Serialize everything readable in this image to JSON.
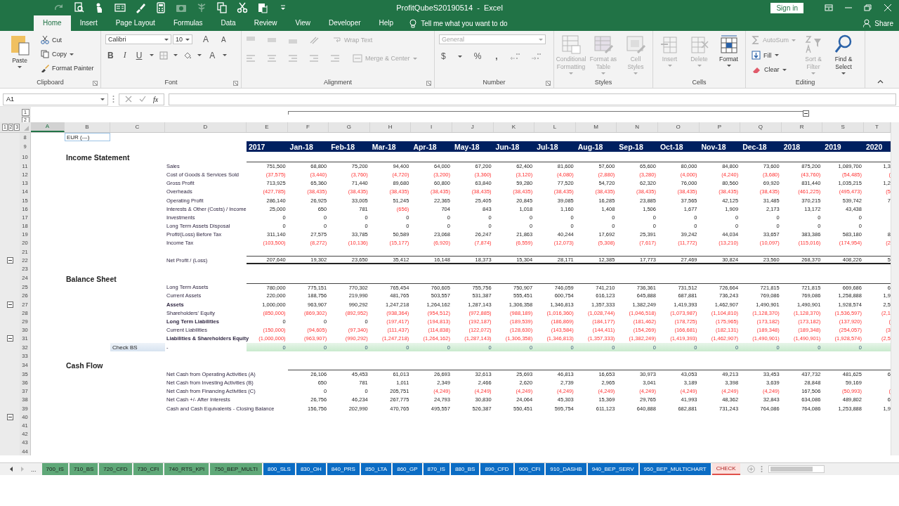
{
  "window": {
    "title": "ProfitQubeS20190514  -  Excel",
    "sign_in": "Sign in"
  },
  "quick_access": [
    {
      "kind": "redo",
      "disabled": true
    },
    {
      "kind": "preview",
      "disabled": false
    },
    {
      "kind": "touch",
      "disabled": false
    },
    {
      "kind": "form",
      "disabled": false
    },
    {
      "kind": "brush",
      "disabled": false
    },
    {
      "kind": "calculator",
      "disabled": false
    },
    {
      "kind": "camera",
      "disabled": true
    },
    {
      "kind": "tree",
      "disabled": true
    },
    {
      "kind": "copy",
      "disabled": false
    },
    {
      "kind": "cut",
      "disabled": false
    },
    {
      "kind": "paste",
      "disabled": false
    },
    {
      "kind": "customize",
      "disabled": false
    }
  ],
  "ribbon_tabs": [
    {
      "label": "Home",
      "selected": true
    },
    {
      "label": "Insert",
      "selected": false
    },
    {
      "label": "Page Layout",
      "selected": false
    },
    {
      "label": "Formulas",
      "selected": false
    },
    {
      "label": "Data",
      "selected": false
    },
    {
      "label": "Review",
      "selected": false
    },
    {
      "label": "View",
      "selected": false
    },
    {
      "label": "Developer",
      "selected": false
    },
    {
      "label": "Help",
      "selected": false
    }
  ],
  "tell_me": "Tell me what you want to do",
  "share": "Share",
  "ribbon": [
    {
      "kind": "clipboard",
      "label": "Clipboard",
      "paste": "Paste",
      "cut": "Cut",
      "copy": "Copy",
      "format_painter": "Format Painter"
    },
    {
      "kind": "font",
      "label": "Font",
      "font_name": "Calibri",
      "font_size": "10",
      "grow": "A",
      "shrink": "A",
      "bold": "B",
      "italic": "I",
      "underline": "U",
      "font_color": "A"
    },
    {
      "kind": "alignment",
      "label": "Alignment",
      "wrap_text": "Wrap Text",
      "merge": "Merge & Center",
      "disabled": true
    },
    {
      "kind": "number",
      "label": "Number",
      "format": "General",
      "currency": "$",
      "percent": "%",
      "comma": ",",
      "disabled": true
    },
    {
      "kind": "styles",
      "label": "Styles",
      "buttons": [
        {
          "label": "Conditional Formatting",
          "disabled": true
        },
        {
          "label": "Format as Table",
          "disabled": true
        },
        {
          "label": "Cell Styles",
          "disabled": true
        }
      ]
    },
    {
      "kind": "cells",
      "label": "Cells",
      "buttons": [
        {
          "label": "Insert",
          "disabled": true
        },
        {
          "label": "Delete",
          "disabled": true
        },
        {
          "label": "Format",
          "disabled": false
        }
      ]
    },
    {
      "kind": "editing",
      "label": "Editing",
      "autosum": {
        "label": "AutoSum",
        "disabled": true
      },
      "fill": "Fill",
      "clear": "Clear",
      "sort": {
        "label": "Sort & Filter",
        "disabled": true
      },
      "find": "Find & Select"
    }
  ],
  "formula_bar": {
    "name_box": "A1",
    "function_label": "fx"
  },
  "outline": {
    "column_levels": [
      "1",
      "2"
    ],
    "row_levels": [
      "1",
      "2",
      "3"
    ]
  },
  "columns": [
    {
      "label": "A",
      "selected": true
    },
    {
      "label": "B",
      "selected": false
    },
    {
      "label": "C",
      "selected": false
    },
    {
      "label": "D",
      "selected": false
    },
    {
      "label": "E",
      "selected": false
    },
    {
      "label": "F",
      "selected": false
    },
    {
      "label": "G",
      "selected": false
    },
    {
      "label": "H",
      "selected": false
    },
    {
      "label": "I",
      "selected": false
    },
    {
      "label": "J",
      "selected": false
    },
    {
      "label": "K",
      "selected": false
    },
    {
      "label": "L",
      "selected": false
    },
    {
      "label": "M",
      "selected": false
    },
    {
      "label": "N",
      "selected": false
    },
    {
      "label": "O",
      "selected": false
    },
    {
      "label": "P",
      "selected": false
    },
    {
      "label": "Q",
      "selected": false
    },
    {
      "label": "R",
      "selected": false
    },
    {
      "label": "S",
      "selected": false
    },
    {
      "label": "T",
      "selected": false
    }
  ],
  "rows": [
    {
      "number": "8",
      "kind": "currency",
      "collapse": false,
      "text": "EUR (---)"
    },
    {
      "number": "9",
      "kind": "header",
      "collapse": false,
      "values": [
        "2017",
        "Jan-18",
        "Feb-18",
        "Mar-18",
        "Apr-18",
        "May-18",
        "Jun-18",
        "Jul-18",
        "Aug-18",
        "Sep-18",
        "Oct-18",
        "Nov-18",
        "Dec-18",
        "2018",
        "2019",
        "2020"
      ]
    },
    {
      "number": "10",
      "kind": "title",
      "collapse": false,
      "text": "Income Statement"
    },
    {
      "number": "11",
      "kind": "line",
      "collapse": false,
      "rule_above": true,
      "label": "Sales",
      "values": [
        "751,500",
        "68,800",
        "75,200",
        "94,400",
        "64,000",
        "67,200",
        "62,400",
        "81,600",
        "57,600",
        "65,600",
        "80,000",
        "84,800",
        "73,600",
        "875,200",
        "1,089,700",
        "1,3"
      ]
    },
    {
      "number": "12",
      "kind": "line",
      "collapse": false,
      "red": true,
      "label": "Cost of Goods & Services Sold",
      "values": [
        "(37,575)",
        "(3,440)",
        "(3,760)",
        "(4,720)",
        "(3,200)",
        "(3,360)",
        "(3,120)",
        "(4,080)",
        "(2,880)",
        "(3,280)",
        "(4,000)",
        "(4,240)",
        "(3,680)",
        "(43,760)",
        "(54,485)",
        "("
      ]
    },
    {
      "number": "13",
      "kind": "line",
      "collapse": false,
      "label": "Gross Profit",
      "values": [
        "713,925",
        "65,360",
        "71,440",
        "89,680",
        "60,800",
        "63,840",
        "59,280",
        "77,520",
        "54,720",
        "62,320",
        "76,000",
        "80,560",
        "69,920",
        "831,440",
        "1,035,215",
        "1,2"
      ]
    },
    {
      "number": "14",
      "kind": "line",
      "collapse": false,
      "red": true,
      "label": "Overheads",
      "values": [
        "(427,785)",
        "(38,435)",
        "(38,435)",
        "(38,435)",
        "(38,435)",
        "(38,435)",
        "(38,435)",
        "(38,435)",
        "(38,435)",
        "(38,435)",
        "(38,435)",
        "(38,435)",
        "(38,435)",
        "(461,225)",
        "(495,473)",
        "(5"
      ]
    },
    {
      "number": "15",
      "kind": "line",
      "collapse": false,
      "label": "Operating Profit",
      "values": [
        "286,140",
        "26,925",
        "33,005",
        "51,245",
        "22,365",
        "25,405",
        "20,845",
        "39,085",
        "16,285",
        "23,885",
        "37,565",
        "42,125",
        "31,485",
        "370,215",
        "539,742",
        "7"
      ]
    },
    {
      "number": "16",
      "kind": "line",
      "collapse": false,
      "label": "Interests & Other (Costs) / Income",
      "red_cells": [
        false,
        false,
        false,
        true,
        false,
        false,
        false,
        false,
        false,
        false,
        false,
        false,
        false,
        false,
        false
      ],
      "values": [
        "25,000",
        "650",
        "781",
        "(656)",
        "704",
        "843",
        "1,018",
        "1,160",
        "1,408",
        "1,506",
        "1,677",
        "1,909",
        "2,173",
        "13,172",
        "43,438"
      ]
    },
    {
      "number": "17",
      "kind": "line",
      "collapse": false,
      "label": "Investments",
      "values": [
        "0",
        "0",
        "0",
        "0",
        "0",
        "0",
        "0",
        "0",
        "0",
        "0",
        "0",
        "0",
        "0",
        "0",
        "0"
      ]
    },
    {
      "number": "18",
      "kind": "line",
      "collapse": false,
      "label": "Long Term Assets Disposal",
      "values": [
        "0",
        "0",
        "0",
        "0",
        "0",
        "0",
        "0",
        "0",
        "0",
        "0",
        "0",
        "0",
        "0",
        "0",
        "0"
      ]
    },
    {
      "number": "19",
      "kind": "line",
      "collapse": false,
      "label": "Profit/(Loss) Before Tax",
      "values": [
        "311,140",
        "27,575",
        "33,785",
        "50,589",
        "23,068",
        "26,247",
        "21,863",
        "40,244",
        "17,692",
        "25,391",
        "39,242",
        "44,034",
        "33,657",
        "383,386",
        "583,180",
        "8"
      ]
    },
    {
      "number": "20",
      "kind": "line",
      "collapse": false,
      "red": true,
      "label": "Income Tax",
      "values": [
        "(103,500)",
        "(8,272)",
        "(10,136)",
        "(15,177)",
        "(6,920)",
        "(7,874)",
        "(6,559)",
        "(12,073)",
        "(5,308)",
        "(7,617)",
        "(11,772)",
        "(13,210)",
        "(10,097)",
        "(115,016)",
        "(174,954)",
        "(2"
      ]
    },
    {
      "number": "21",
      "kind": "blank",
      "collapse": false
    },
    {
      "number": "22",
      "kind": "line",
      "collapse": true,
      "total": true,
      "label": "Net Profit / (Loss)",
      "values": [
        "207,640",
        "19,302",
        "23,650",
        "35,412",
        "16,148",
        "18,373",
        "15,304",
        "28,171",
        "12,385",
        "17,773",
        "27,469",
        "30,824",
        "23,560",
        "268,370",
        "408,226",
        "5"
      ]
    },
    {
      "number": "23",
      "kind": "blank",
      "collapse": false
    },
    {
      "number": "24",
      "kind": "title",
      "collapse": false,
      "text": "Balance Sheet"
    },
    {
      "number": "25",
      "kind": "line",
      "collapse": false,
      "rule_above": true,
      "label": "Long Term Assets",
      "values": [
        "780,000",
        "775,151",
        "770,302",
        "765,454",
        "760,605",
        "755,756",
        "750,907",
        "746,059",
        "741,210",
        "736,361",
        "731,512",
        "726,664",
        "721,815",
        "721,815",
        "669,686",
        "6"
      ]
    },
    {
      "number": "26",
      "kind": "line",
      "collapse": false,
      "label": "Current Assets",
      "values": [
        "220,000",
        "188,756",
        "219,990",
        "481,765",
        "503,557",
        "531,387",
        "555,451",
        "600,754",
        "616,123",
        "645,888",
        "687,881",
        "736,243",
        "769,086",
        "769,086",
        "1,258,888",
        "1,9"
      ]
    },
    {
      "number": "27",
      "kind": "line",
      "collapse": true,
      "bold": true,
      "label": "Assets",
      "values": [
        "1,000,000",
        "963,907",
        "990,292",
        "1,247,218",
        "1,264,162",
        "1,287,143",
        "1,306,358",
        "1,346,813",
        "1,357,333",
        "1,382,249",
        "1,419,393",
        "1,462,907",
        "1,490,901",
        "1,490,901",
        "1,928,574",
        "2,5"
      ]
    },
    {
      "number": "28",
      "kind": "line",
      "collapse": false,
      "red": true,
      "label": "Shareholders' Equity",
      "values": [
        "(850,000)",
        "(869,302)",
        "(892,952)",
        "(938,364)",
        "(954,512)",
        "(972,885)",
        "(988,189)",
        "(1,016,360)",
        "(1,028,744)",
        "(1,046,518)",
        "(1,073,987)",
        "(1,104,810)",
        "(1,128,370)",
        "(1,128,370)",
        "(1,536,597)",
        "(2,1"
      ]
    },
    {
      "number": "29",
      "kind": "line",
      "collapse": false,
      "bold": true,
      "label": "Long Term Liabilities",
      "red_cells": [
        false,
        false,
        false,
        true,
        true,
        true,
        true,
        true,
        true,
        true,
        true,
        true,
        true,
        true,
        true,
        true
      ],
      "values": [
        "0",
        "0",
        "0",
        "(197,417)",
        "(194,813)",
        "(192,187)",
        "(189,539)",
        "(186,869)",
        "(184,177)",
        "(181,462)",
        "(178,725)",
        "(175,965)",
        "(173,182)",
        "(173,182)",
        "(137,920)",
        "("
      ]
    },
    {
      "number": "30",
      "kind": "line",
      "collapse": false,
      "red": true,
      "label": "Current Liabilities",
      "values": [
        "(150,000)",
        "(94,605)",
        "(97,340)",
        "(111,437)",
        "(114,838)",
        "(122,072)",
        "(128,630)",
        "(143,584)",
        "(144,411)",
        "(154,269)",
        "(166,681)",
        "(182,131)",
        "(189,348)",
        "(189,348)",
        "(254,057)",
        "(3"
      ]
    },
    {
      "number": "31",
      "kind": "line",
      "collapse": true,
      "bold": true,
      "red": true,
      "label": "Liabilities & Shareholders Equity",
      "values": [
        "(1,000,000)",
        "(963,907)",
        "(990,292)",
        "(1,247,218)",
        "(1,264,162)",
        "(1,287,143)",
        "(1,306,358)",
        "(1,346,813)",
        "(1,357,333)",
        "(1,382,249)",
        "(1,419,393)",
        "(1,462,907)",
        "(1,490,901)",
        "(1,490,901)",
        "(1,928,574)",
        "(2,5"
      ]
    },
    {
      "number": "32",
      "kind": "check",
      "collapse": false,
      "text": "Check BS",
      "label": "-",
      "values": [
        "0",
        "0",
        "0",
        "0",
        "0",
        "0",
        "0",
        "0",
        "0",
        "0",
        "0",
        "0",
        "0",
        "0",
        "0"
      ]
    },
    {
      "number": "33",
      "kind": "blank",
      "collapse": false
    },
    {
      "number": "34",
      "kind": "title",
      "collapse": false,
      "text": "Cash Flow"
    },
    {
      "number": "35",
      "kind": "cash_line",
      "collapse": false,
      "rule_above": true,
      "label": "Net Cash from Operating Activities (A)",
      "values": [
        "26,106",
        "45,453",
        "61,013",
        "26,693",
        "32,613",
        "25,693",
        "46,813",
        "16,653",
        "30,973",
        "43,053",
        "49,213",
        "33,453",
        "437,732",
        "481,625",
        "6"
      ]
    },
    {
      "number": "36",
      "kind": "cash_line",
      "collapse": false,
      "label": "Net Cash from Investing Activities (B)",
      "values": [
        "650",
        "781",
        "1,011",
        "2,349",
        "2,466",
        "2,620",
        "2,739",
        "2,965",
        "3,041",
        "3,189",
        "3,398",
        "3,639",
        "28,848",
        "59,169"
      ]
    },
    {
      "number": "37",
      "kind": "cash_line",
      "collapse": false,
      "label": "Net Cash from Financing Activities (C)",
      "red_cells": [
        false,
        false,
        false,
        true,
        true,
        true,
        true,
        true,
        true,
        true,
        true,
        true,
        false,
        true,
        true
      ],
      "values": [
        "0",
        "0",
        "205,751",
        "(4,249)",
        "(4,249)",
        "(4,249)",
        "(4,249)",
        "(4,249)",
        "(4,249)",
        "(4,249)",
        "(4,249)",
        "(4,249)",
        "167,506",
        "(50,993)",
        "("
      ]
    },
    {
      "number": "38",
      "kind": "cash_line",
      "collapse": false,
      "label": "Net Cash +/- After Interests",
      "values": [
        "26,756",
        "46,234",
        "267,775",
        "24,793",
        "30,830",
        "24,064",
        "45,303",
        "15,369",
        "29,765",
        "41,993",
        "48,362",
        "32,843",
        "634,086",
        "489,802",
        "6"
      ]
    },
    {
      "number": "39",
      "kind": "cash_line",
      "collapse": false,
      "label": "Cash and Cash Equivalents - Closing Balance",
      "values": [
        "156,756",
        "202,990",
        "470,765",
        "495,557",
        "526,387",
        "550,451",
        "595,754",
        "611,123",
        "640,888",
        "682,881",
        "731,243",
        "764,086",
        "764,086",
        "1,253,888",
        "1,9"
      ]
    },
    {
      "number": "40",
      "kind": "blank",
      "collapse": true
    },
    {
      "number": "41",
      "kind": "blank",
      "collapse": false
    },
    {
      "number": "42",
      "kind": "blank",
      "collapse": false
    },
    {
      "number": "43",
      "kind": "blank",
      "collapse": false
    },
    {
      "number": "44",
      "kind": "blank",
      "collapse": false
    }
  ],
  "sheet_nav": {
    "more": "..."
  },
  "sheet_tabs": [
    {
      "label": "700_IS",
      "color": "#5fa878",
      "selected": false
    },
    {
      "label": "710_BS",
      "color": "#5fa878",
      "selected": false
    },
    {
      "label": "720_CFD",
      "color": "#5fa878",
      "selected": false
    },
    {
      "label": "730_CFI",
      "color": "#5fa878",
      "selected": false
    },
    {
      "label": "740_RTS_KPI",
      "color": "#5fa878",
      "selected": false
    },
    {
      "label": "750_BEP_MULTI",
      "color": "#5fa878",
      "selected": false
    },
    {
      "label": "800_SLS",
      "color": "#0b6cc4",
      "selected": false
    },
    {
      "label": "830_OH",
      "color": "#0b6cc4",
      "selected": false
    },
    {
      "label": "840_PRS",
      "color": "#0b6cc4",
      "selected": false
    },
    {
      "label": "850_LTA",
      "color": "#0b6cc4",
      "selected": false
    },
    {
      "label": "860_GP",
      "color": "#0b6cc4",
      "selected": false
    },
    {
      "label": "870_IS",
      "color": "#0b6cc4",
      "selected": false
    },
    {
      "label": "880_BS",
      "color": "#0b6cc4",
      "selected": false
    },
    {
      "label": "890_CFD",
      "color": "#0b6cc4",
      "selected": false
    },
    {
      "label": "900_CFI",
      "color": "#0b6cc4",
      "selected": false
    },
    {
      "label": "910_DASHB",
      "color": "#0b6cc4",
      "selected": false
    },
    {
      "label": "940_BEP_SERV",
      "color": "#0b6cc4",
      "selected": false
    },
    {
      "label": "950_BEP_MULTICHART",
      "color": "#0b6cc4",
      "selected": false
    },
    {
      "label": "CHECK",
      "color": "#e0504a",
      "selected": true
    }
  ]
}
